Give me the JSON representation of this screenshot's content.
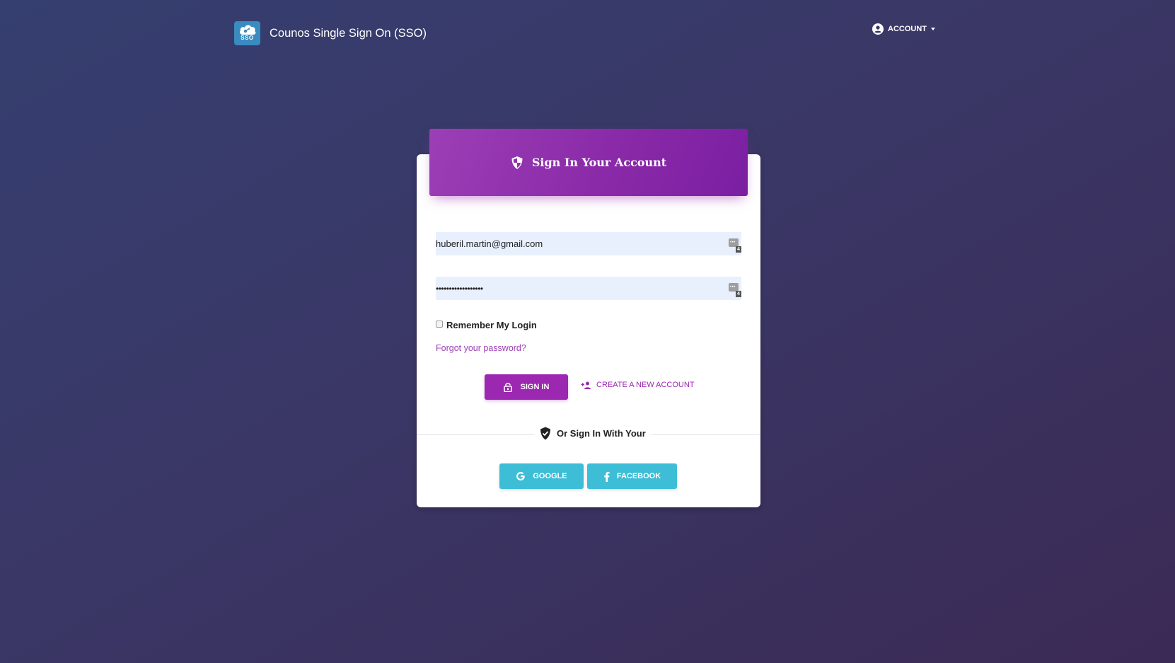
{
  "navbar": {
    "logo_text": "SSO",
    "brand_title": "Counos Single Sign On (SSO)",
    "account_label": "ACCOUNT"
  },
  "card": {
    "title": "Sign In Your Account",
    "email_field": {
      "value": "huberil.martin@gmail.com",
      "type": "email"
    },
    "password_field": {
      "value": "••••••••••••••••••",
      "type": "password"
    },
    "password_manager_badge": "4",
    "remember_label": "Remember My Login",
    "remember_checked": false,
    "forgot_link": "Forgot your password?",
    "sign_in_button": "SIGN IN",
    "create_account_button": "CREATE A NEW ACCOUNT",
    "divider_label": "Or Sign In With Your",
    "social": {
      "google": "GOOGLE",
      "facebook": "FACEBOOK"
    }
  },
  "colors": {
    "accent": "#9c27b0",
    "social": "#3dbdd6",
    "input_bg": "#e8f0fe",
    "logo_bg": "#3a8bc0"
  }
}
